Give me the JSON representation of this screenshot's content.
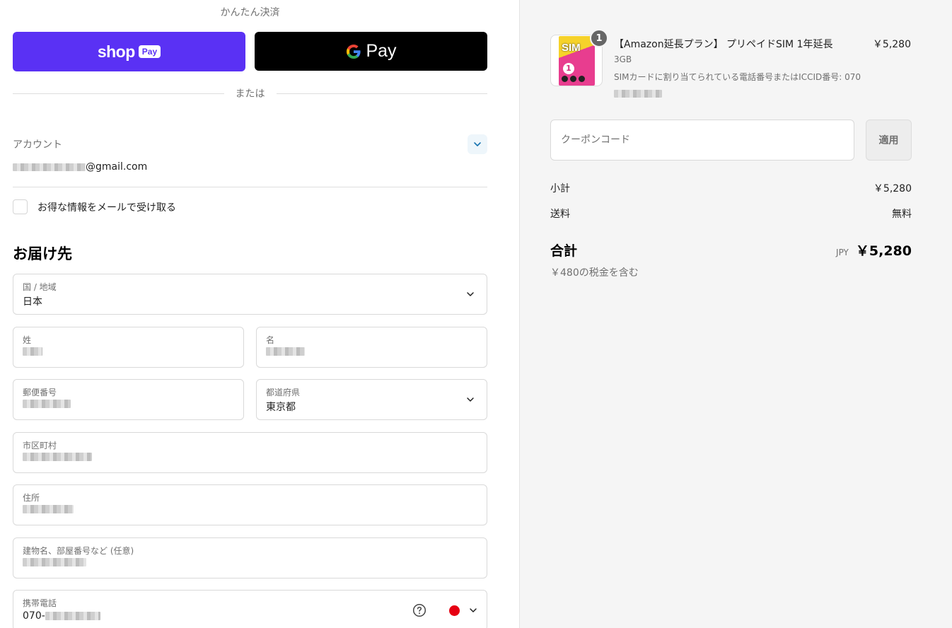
{
  "express": {
    "title": "かんたん決済",
    "shop_pay_word": "shop",
    "shop_pay_badge": "Pay",
    "gpay_g": "G",
    "gpay_word": "Pay",
    "shop_pay_color": "#5a31f4"
  },
  "divider": {
    "label": "または"
  },
  "account": {
    "label": "アカウント",
    "email_suffix": "@gmail.com",
    "newsletter_label": "お得な情報をメールで受け取る"
  },
  "shipping": {
    "title": "お届け先",
    "country": {
      "label": "国 / 地域",
      "value": "日本"
    },
    "last_name": {
      "label": "姓"
    },
    "first_name": {
      "label": "名"
    },
    "postal_code": {
      "label": "郵便番号"
    },
    "prefecture": {
      "label": "都道府県",
      "value": "東京都"
    },
    "city": {
      "label": "市区町村"
    },
    "address": {
      "label": "住所"
    },
    "building": {
      "label": "建物名、部屋番号など (任意)"
    },
    "phone": {
      "label": "携帯電話",
      "value_prefix": "070-",
      "flag_color": "#e60012"
    }
  },
  "order": {
    "item": {
      "quantity": "1",
      "name": "【Amazon延長プラン】 プリペイドSIM 1年延長",
      "price": "￥5,280",
      "variant": "3GB",
      "note": "SIMカードに割り当てられている電話番号またはICCID番号: 070",
      "thumb_text": "SIM",
      "thumb_number": "1"
    },
    "coupon": {
      "placeholder": "クーポンコード",
      "apply_label": "適用"
    },
    "subtotal": {
      "label": "小計",
      "value": "￥5,280"
    },
    "shipping": {
      "label": "送料",
      "value": "無料"
    },
    "total": {
      "label": "合計",
      "currency": "JPY",
      "value": "￥5,280"
    },
    "tax_note": "￥480の税金を含む"
  }
}
